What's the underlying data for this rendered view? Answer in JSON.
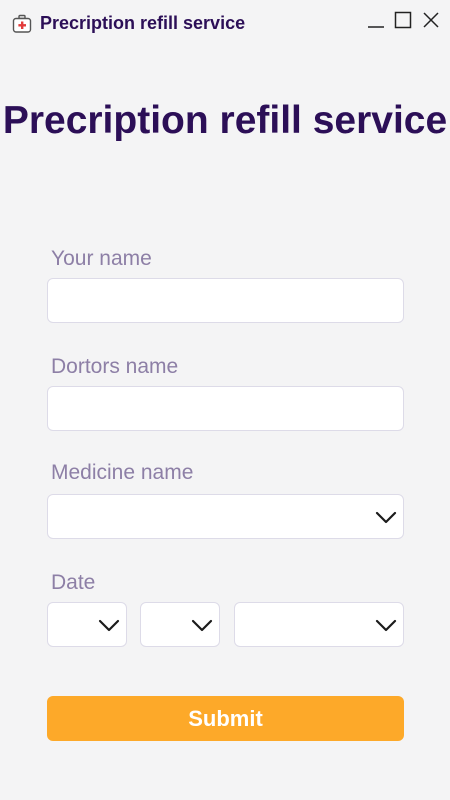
{
  "window": {
    "title": "Precription refill service",
    "icon": "medical-kit-icon",
    "controls": [
      "minimize-icon",
      "maximize-icon",
      "close-icon"
    ]
  },
  "page": {
    "title": "Precription refill service"
  },
  "form": {
    "name": {
      "label": "Your name",
      "value": "",
      "placeholder": ""
    },
    "doctor": {
      "label": "Dortors name",
      "value": "",
      "placeholder": ""
    },
    "medicine": {
      "label": "Medicine name",
      "selected": ""
    },
    "date": {
      "label": "Date",
      "day": "",
      "month": "",
      "year": ""
    },
    "submit_label": "Submit"
  },
  "colors": {
    "brand": "#2c0f57",
    "label": "#8d7fa6",
    "accent": "#fda929",
    "background": "#f4f4f5",
    "field_border": "#dddbe8"
  }
}
